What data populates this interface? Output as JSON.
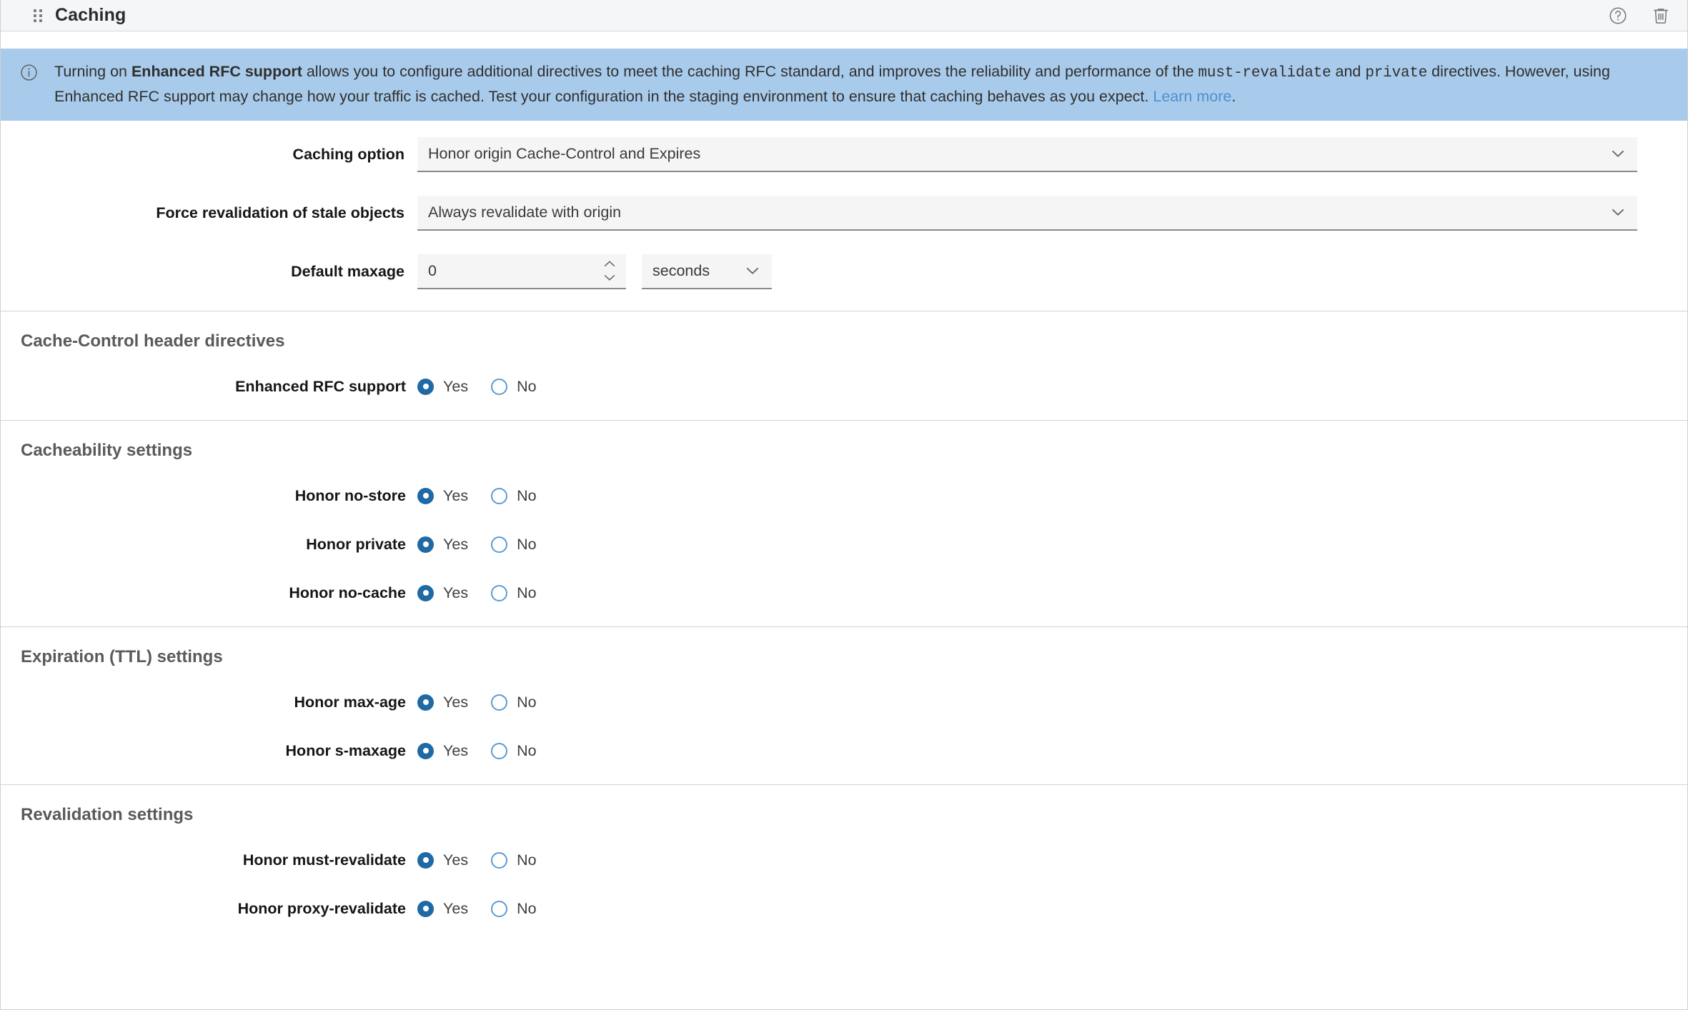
{
  "panel": {
    "title": "Caching",
    "drag_handle_icon": "drag-dots-icon",
    "help_icon": "help-circle-icon",
    "delete_icon": "trash-icon"
  },
  "banner": {
    "icon": "info-circle-icon",
    "line1_part1": "Turning on ",
    "line1_bold": "Enhanced RFC support",
    "line1_part2": " allows you to configure additional directives to meet the caching RFC standard, and improves the reliability and performance of the ",
    "mono1": "must-revalidate",
    "line1_part3": " and ",
    "mono2": "private",
    "line2": " directives. However, using Enhanced RFC support may change how your traffic is cached. Test your configuration in the staging environment to ensure that caching behaves as you expect. ",
    "link_label": "Learn more",
    "line2_end": ".",
    "background_color": "#a9cbeb",
    "link_color": "#4e8fd0"
  },
  "form": {
    "caching_option": {
      "label": "Caching option",
      "value": "Honor origin Cache-Control and Expires",
      "chevron_icon": "chevron-down-icon"
    },
    "force_revalidation": {
      "label": "Force revalidation of stale objects",
      "value": "Always revalidate with origin",
      "chevron_icon": "chevron-down-icon"
    },
    "default_maxage": {
      "label": "Default maxage",
      "value": "0",
      "placeholder": "0",
      "increment_icon": "chevron-up-icon",
      "decrement_icon": "chevron-down-icon",
      "unit_value": "seconds",
      "unit_chevron_icon": "chevron-down-icon"
    }
  },
  "radio_options": {
    "yes": "Yes",
    "no": "No"
  },
  "sections": [
    {
      "title": "Cache-Control header directives",
      "rows": [
        {
          "label": "Enhanced RFC support",
          "selected": "yes"
        }
      ]
    },
    {
      "title": "Cacheability settings",
      "rows": [
        {
          "label": "Honor no-store",
          "selected": "yes"
        },
        {
          "label": "Honor private",
          "selected": "yes"
        },
        {
          "label": "Honor no-cache",
          "selected": "yes"
        }
      ]
    },
    {
      "title": "Expiration (TTL) settings",
      "rows": [
        {
          "label": "Honor max-age",
          "selected": "yes"
        },
        {
          "label": "Honor s-maxage",
          "selected": "yes"
        }
      ]
    },
    {
      "title": "Revalidation settings",
      "rows": [
        {
          "label": "Honor must-revalidate",
          "selected": "yes"
        },
        {
          "label": "Honor proxy-revalidate",
          "selected": "yes"
        }
      ]
    }
  ],
  "colors": {
    "radio_selected": "#1f6aa5",
    "radio_unselected_border": "#5b9bd5",
    "header_bg": "#f5f6f7",
    "field_bg": "#f5f5f5"
  }
}
